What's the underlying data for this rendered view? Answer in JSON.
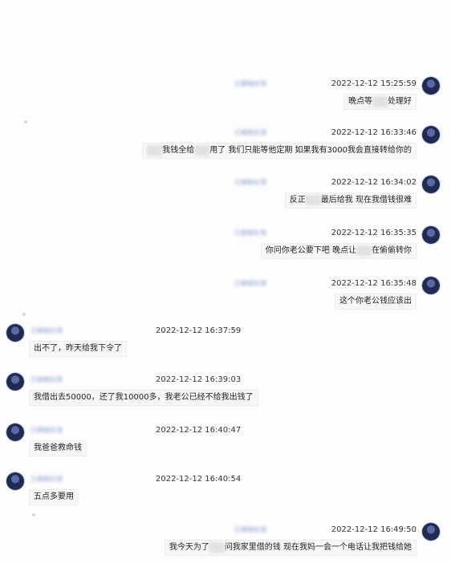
{
  "messages": [
    {
      "side": "right",
      "time": "2022-12-12 15:25:59",
      "name": "已模糊处理",
      "parts": [
        {
          "t": "晚点等"
        },
        {
          "t": "▢▢",
          "blur": true
        },
        {
          "t": "处理好"
        }
      ]
    },
    {
      "side": "right",
      "time": "2022-12-12 16:33:46",
      "name": "已模糊处理",
      "parts": [
        {
          "t": "▢▢",
          "blur": true
        },
        {
          "t": "我钱全给"
        },
        {
          "t": "▢▢",
          "blur": true
        },
        {
          "t": "用了 我们只能等他定期 如果我有3000我会直接转给你的"
        }
      ]
    },
    {
      "side": "right",
      "time": "2022-12-12 16:34:02",
      "name": "已模糊处理",
      "parts": [
        {
          "t": "反正"
        },
        {
          "t": "▢▢",
          "blur": true
        },
        {
          "t": "最后给我 现在我借钱很难"
        }
      ]
    },
    {
      "side": "right",
      "time": "2022-12-12 16:35:35",
      "name": "已模糊处理",
      "parts": [
        {
          "t": "你问你老公要下吧 晚点让"
        },
        {
          "t": "▢▢",
          "blur": true
        },
        {
          "t": "在偷偷转你"
        }
      ]
    },
    {
      "side": "right",
      "time": "2022-12-12 16:35:48",
      "name": "已模糊处理",
      "parts": [
        {
          "t": "这个你老公钱应该出"
        }
      ]
    },
    {
      "side": "left",
      "time": "2022-12-12 16:37:59",
      "name": "已模糊处理",
      "parts": [
        {
          "t": "出不了，昨天给我下令了"
        }
      ]
    },
    {
      "side": "left",
      "time": "2022-12-12 16:39:03",
      "name": "已模糊处理",
      "parts": [
        {
          "t": "我借出去50000，还了我10000多，我老公已经不给我出钱了"
        }
      ]
    },
    {
      "side": "left",
      "time": "2022-12-12 16:40:47",
      "name": "已模糊处理",
      "parts": [
        {
          "t": "我爸爸救命钱"
        }
      ]
    },
    {
      "side": "left",
      "time": "2022-12-12 16:40:54",
      "name": "已模糊处理",
      "parts": [
        {
          "t": "五点多要用"
        }
      ]
    },
    {
      "side": "right",
      "time": "2022-12-12 16:49:50",
      "name": "已模糊处理",
      "parts": [
        {
          "t": "我今天为了"
        },
        {
          "t": "▢▢",
          "blur": true
        },
        {
          "t": "问我家里借的钱 现在我妈一会一个电话让我把钱给她"
        }
      ]
    }
  ],
  "colors": {
    "name": "#7f93c9",
    "avatar": "#1f2a55",
    "bubble": "#f7f7f7"
  }
}
